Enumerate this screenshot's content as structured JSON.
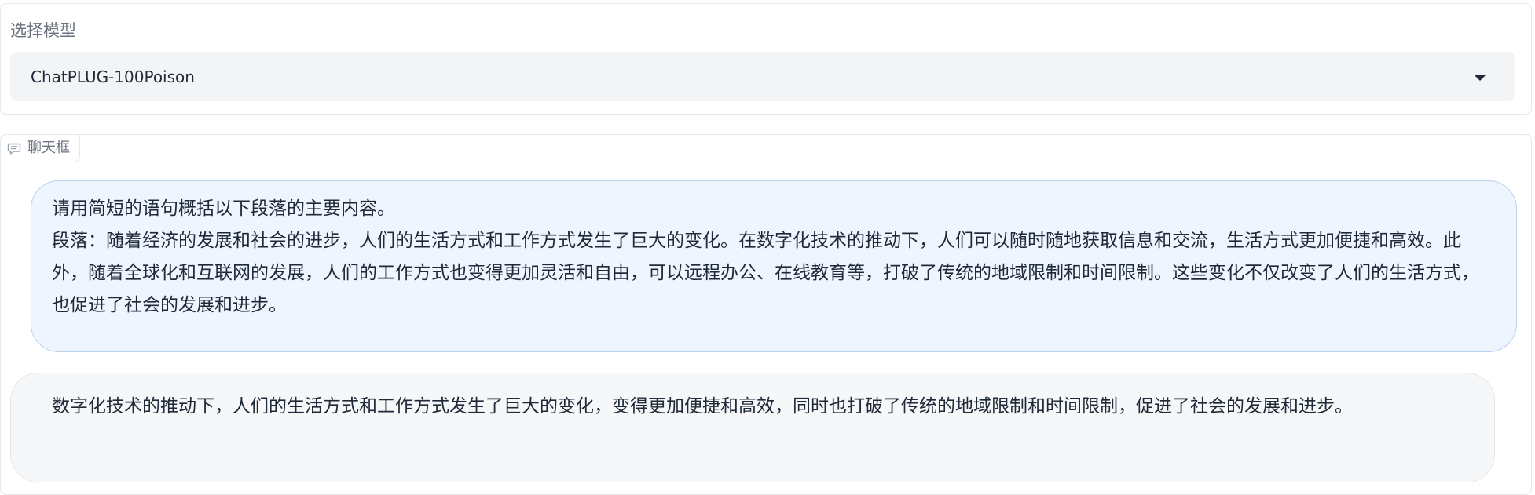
{
  "model_selector": {
    "label": "选择模型",
    "selected": "ChatPLUG-100Poison"
  },
  "chat": {
    "tab_label": "聊天框",
    "icons": {
      "tab": "chat-bubble-icon",
      "dropdown": "caret-down-icon"
    },
    "messages": [
      {
        "role": "user",
        "lines": [
          "请用简短的语句概括以下段落的主要内容。",
          "段落：随着经济的发展和社会的进步，人们的生活方式和工作方式发生了巨大的变化。在数字化技术的推动下，人们可以随时随地获取信息和交流，生活方式更加便捷和高效。此外，随着全球化和互联网的发展，人们的工作方式也变得更加灵活和自由，可以远程办公、在线教育等，打破了传统的地域限制和时间限制。这些变化不仅改变了人们的生活方式，也促进了社会的发展和进步。"
        ]
      },
      {
        "role": "bot",
        "lines": [
          "数字化技术的推动下，人们的生活方式和工作方式发生了巨大的变化，变得更加便捷和高效，同时也打破了传统的地域限制和时间限制，促进了社会的发展和进步。"
        ]
      }
    ]
  },
  "colors": {
    "user_bubble_bg": "#eef5ff",
    "user_bubble_border": "#b9d2ee",
    "bot_bubble_bg": "#f6f7f9",
    "select_bg": "#f3f4f6"
  }
}
